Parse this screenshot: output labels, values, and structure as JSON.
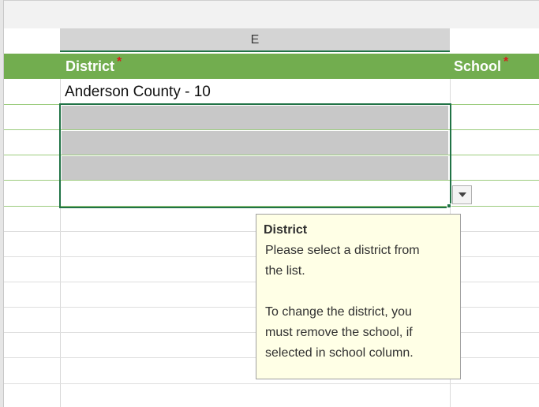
{
  "columns": {
    "e_header": "E"
  },
  "header_row": {
    "district_label": "District",
    "school_label": "School",
    "required_marker": "*"
  },
  "cells": {
    "district_value": "Anderson County - 10"
  },
  "tooltip": {
    "title": "District",
    "line1": "Please select a district from",
    "line2": "the list.",
    "line3": "To change the district, you",
    "line4": "must remove the school, if",
    "line5": "selected in school column."
  },
  "colors": {
    "header_green": "#72ad4f",
    "selection_border": "#217346",
    "required_marker": "#d61d1d",
    "tooltip_bg": "#ffffe6",
    "placeholder_gray": "#c8c8c8"
  },
  "icons": {
    "dropdown": "triangle-down-icon"
  }
}
